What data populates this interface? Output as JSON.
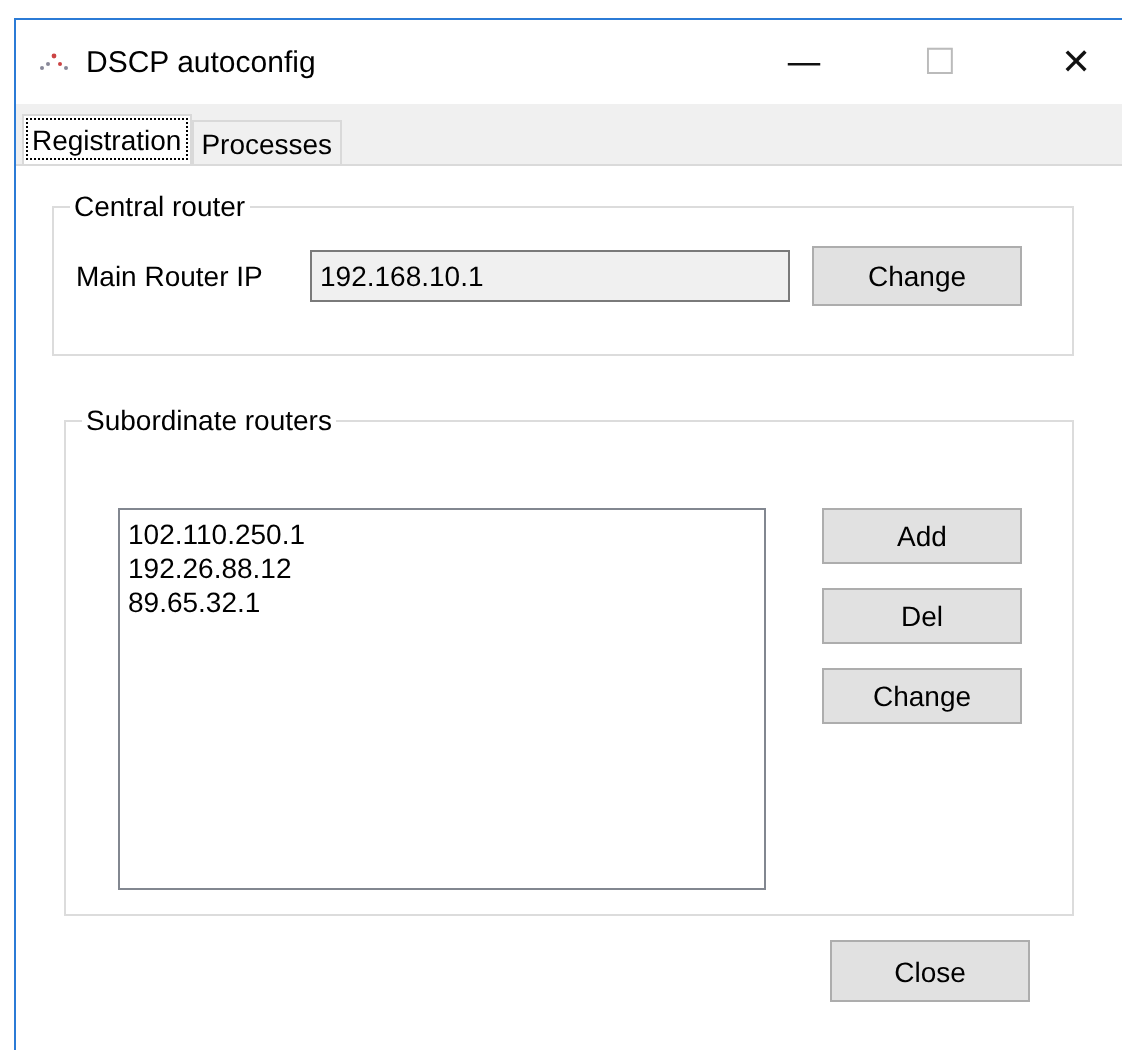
{
  "window": {
    "title": "DSCP autoconfig",
    "controls": [
      "—",
      "☐",
      "✕"
    ]
  },
  "tabs": [
    {
      "label": "Registration",
      "selected": true
    },
    {
      "label": "Processes",
      "selected": false
    }
  ],
  "central_router": {
    "title": "Central router",
    "label": "Main Router IP",
    "value": "192.168.10.1",
    "button": "Change"
  },
  "subordinate_routers": {
    "title": "Subordinate routers",
    "items": [
      "102.110.250.1",
      "192.26.88.12",
      "89.65.32.1"
    ],
    "buttons": [
      "Add",
      "Del",
      "Change"
    ]
  },
  "close_button": "Close"
}
